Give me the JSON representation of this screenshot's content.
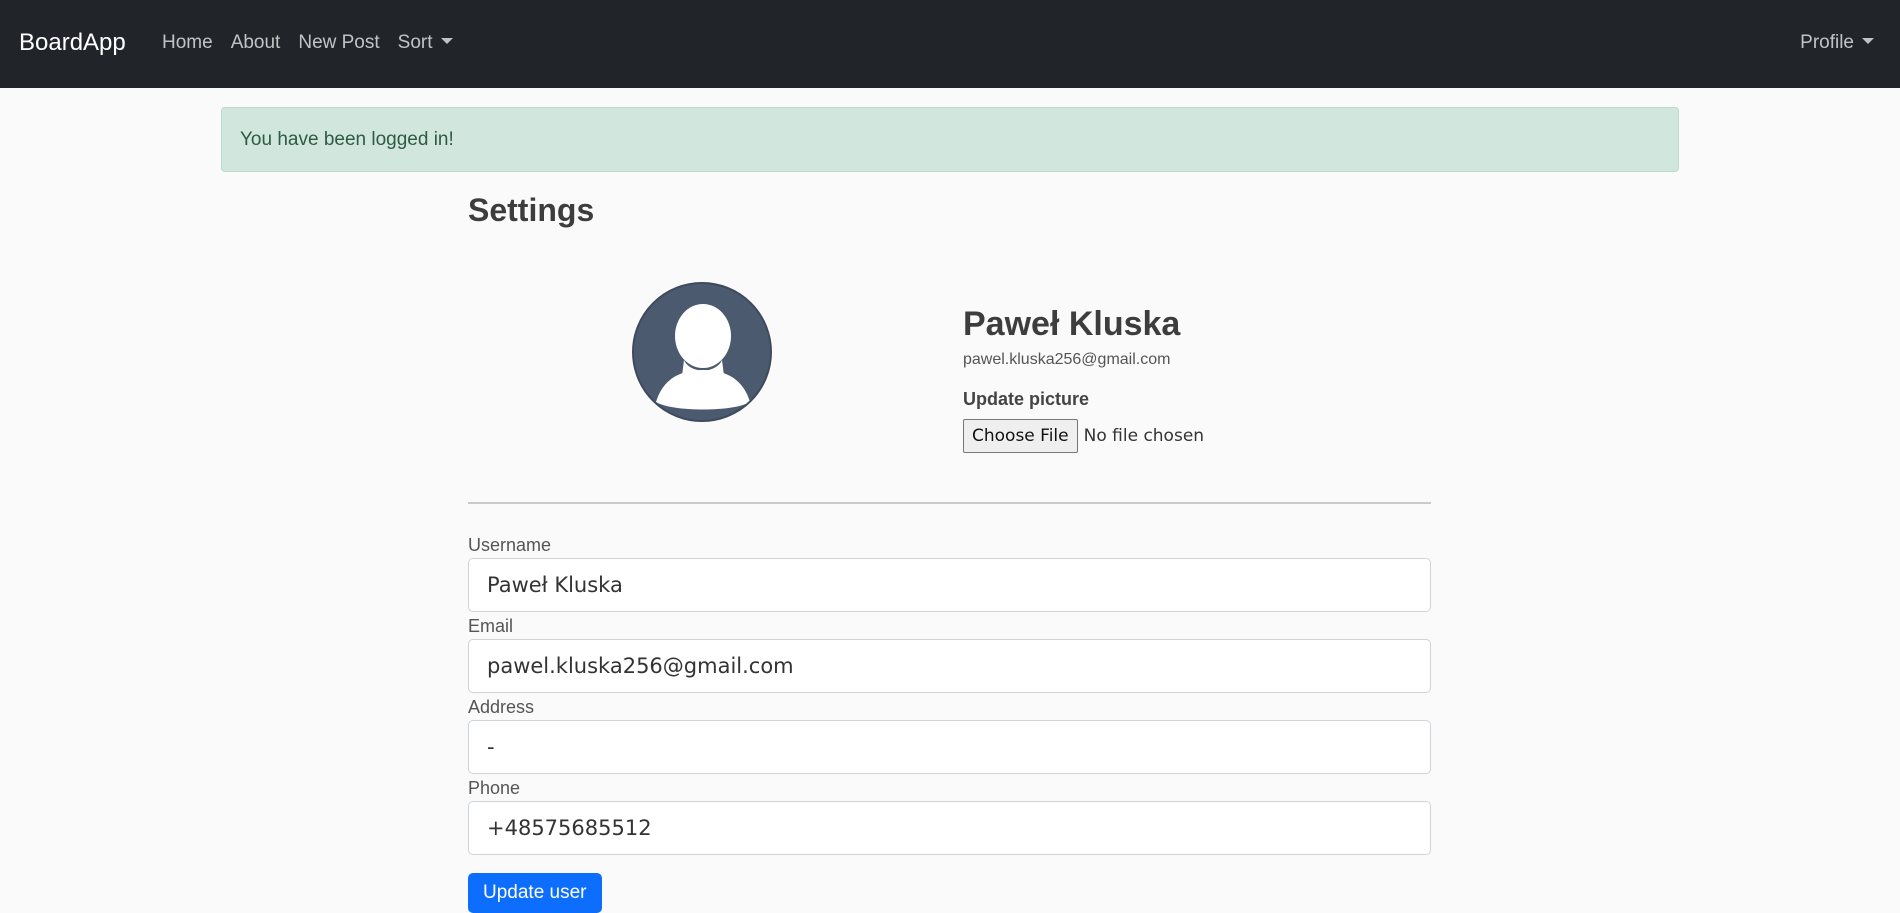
{
  "navbar": {
    "brand": "BoardApp",
    "links": [
      "Home",
      "About",
      "New Post",
      "Sort"
    ],
    "profile_label": "Profile"
  },
  "alert": {
    "message": "You have been logged in!"
  },
  "settings": {
    "title": "Settings",
    "name": "Paweł Kluska",
    "email": "pawel.kluska256@gmail.com",
    "update_picture_label": "Update picture",
    "file_button_label": "Choose File",
    "file_status": "No file chosen"
  },
  "form": {
    "fields": [
      {
        "label": "Username",
        "value": "Paweł Kluska"
      },
      {
        "label": "Email",
        "value": "pawel.kluska256@gmail.com"
      },
      {
        "label": "Address",
        "value": "-"
      },
      {
        "label": "Phone",
        "value": "+48575685512"
      }
    ],
    "submit_label": "Update user"
  },
  "colors": {
    "navbar_bg": "#212529",
    "alert_bg": "#d1e7dd",
    "primary": "#0d6efd",
    "avatar_bg": "#4b5a6f"
  }
}
